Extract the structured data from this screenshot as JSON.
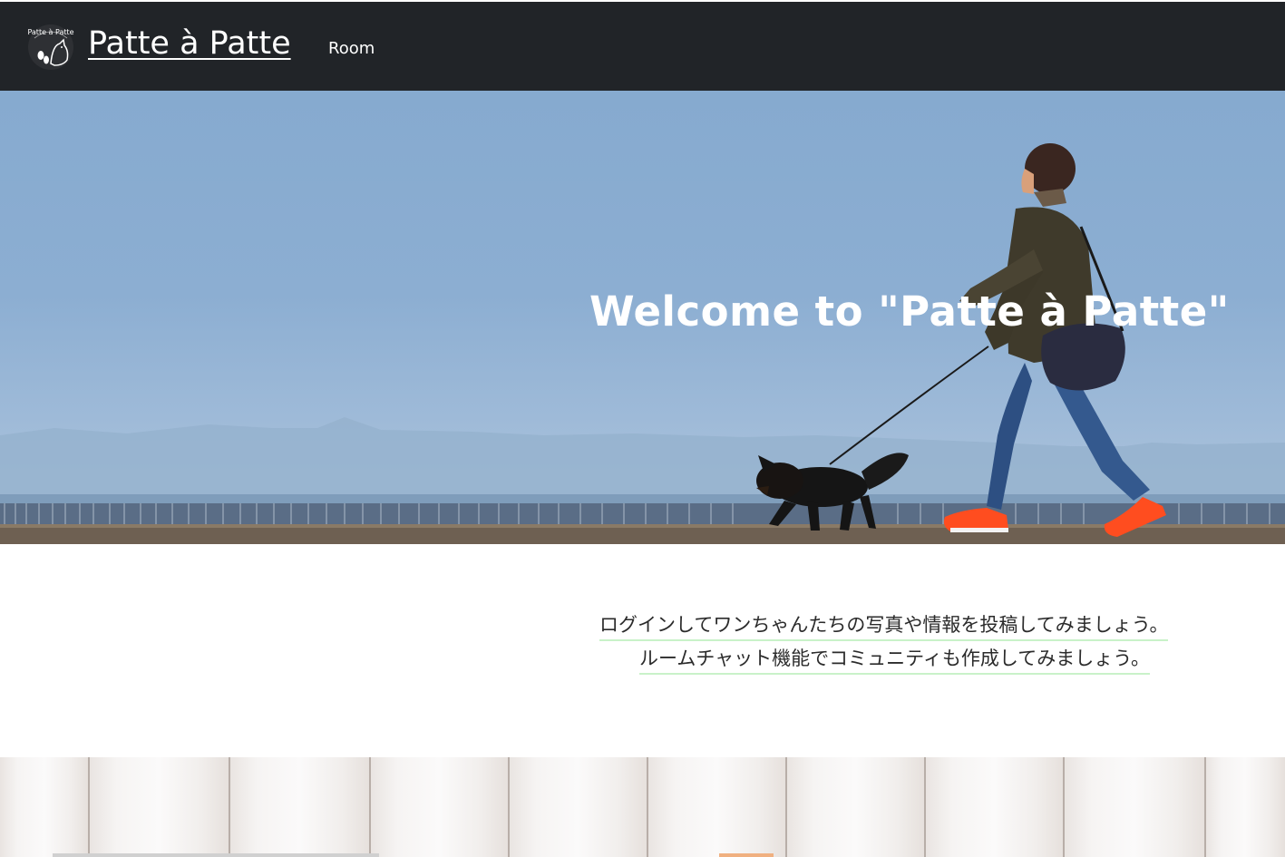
{
  "navbar": {
    "brand": "Patte à Patte",
    "logo_text": "Patte à Patte",
    "logo_icon": "dog-paw-logo-icon",
    "links": [
      {
        "label": "Room"
      }
    ]
  },
  "hero": {
    "title": "Welcome to \"Patte à Patte\""
  },
  "intro": {
    "line1": "ログインしてワンちゃんたちの写真や情報を投稿してみましょう。",
    "line2": "ルームチャット機能でコミュニティも作成してみましょう。"
  },
  "colors": {
    "navbar_bg": "#212428",
    "sky": "#8caed2",
    "text_underline": "#c9f2c9",
    "shoes": "#ff4d1f"
  }
}
